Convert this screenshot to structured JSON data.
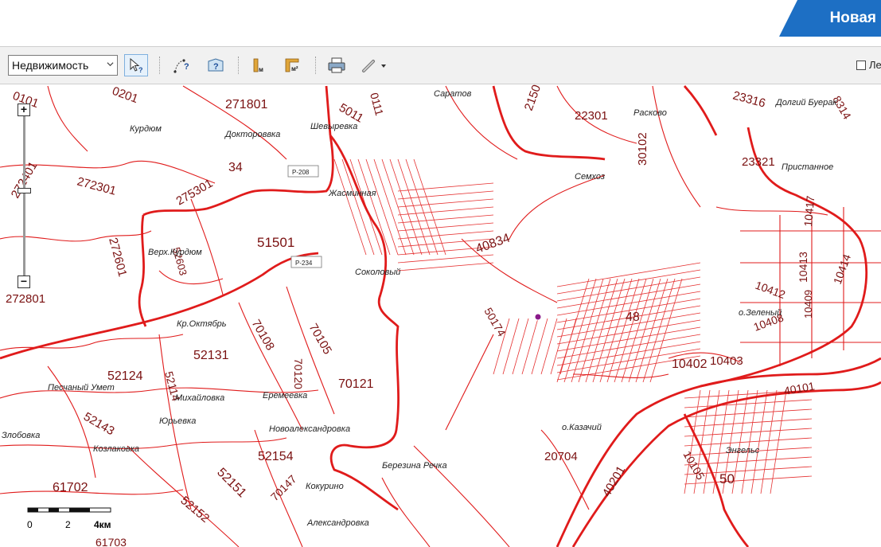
{
  "header": {
    "new_tab_label": "Новая"
  },
  "toolbar": {
    "layer_select_value": "Недвижимость",
    "checkbox_label": "Ле"
  },
  "map": {
    "zoom_in_label": "+",
    "zoom_out_label": "−",
    "scale": {
      "labels": [
        "0",
        "2",
        "4км"
      ]
    },
    "parcels": [
      "271801",
      "5011",
      "22301",
      "2150",
      "23316",
      "8314",
      "275301",
      "34",
      "272401",
      "272301",
      "30102",
      "23321",
      "51501",
      "52603",
      "272601",
      "40834",
      "10417",
      "10412",
      "10413",
      "10414",
      "50174",
      "48",
      "10408",
      "10409",
      "70108",
      "70105",
      "52131",
      "70120",
      "10402",
      "10403",
      "52124",
      "52114",
      "70121",
      "40101",
      "52143",
      "61702",
      "52154",
      "52151",
      "20704",
      "10105",
      "40201",
      "70147",
      "52152",
      "50",
      "272801",
      "0101",
      "0201",
      "0111",
      "61703"
    ],
    "places": [
      "Курдюм",
      "Доктороввка",
      "Шевыревка",
      "Саратов",
      "Расково",
      "Долгий Буерак",
      "Пристанное",
      "Семхоз",
      "Жасминная",
      "Верх.Курдюм",
      "Соколовый",
      "Кр.Октябрь",
      "о.Зеленый",
      "Песчаный Умет",
      "Михайловка",
      "Еремеевка",
      "Юрьевка",
      "Злобовка",
      "Новоалександровка",
      "Козлаковка",
      "о.Казачий",
      "Энгельс",
      "Березина Речка",
      "Кокурино",
      "Александровка",
      "Р-208",
      "Р-234"
    ]
  }
}
